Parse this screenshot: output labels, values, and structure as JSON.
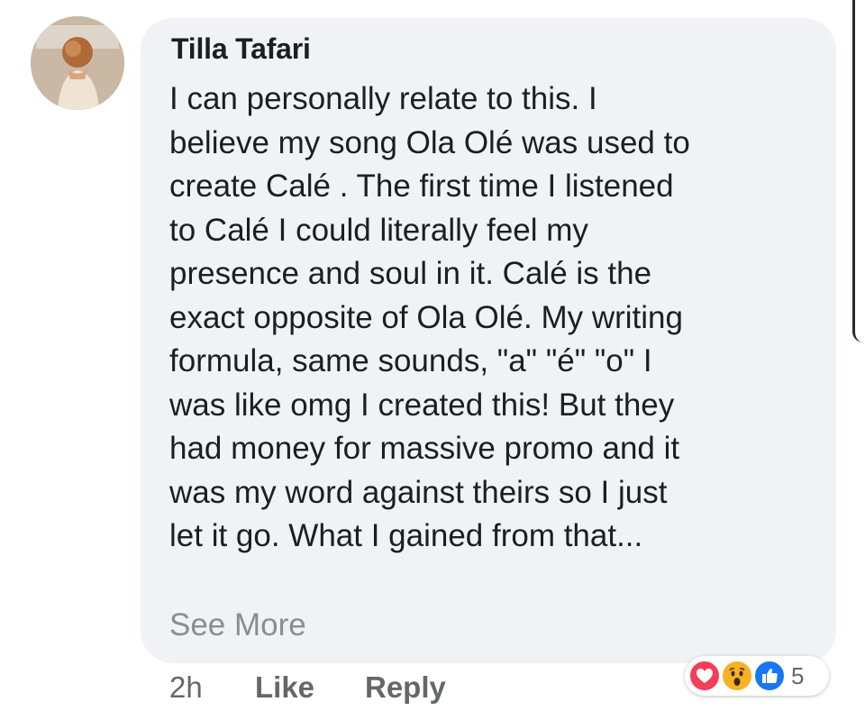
{
  "comment": {
    "author": "Tilla Tafari",
    "text_lines": [
      "I can personally relate to this. I",
      "believe my song Ola Olé was used to",
      "create Calé . The first time I listened",
      "to Calé I could literally feel my",
      "presence and soul in it. Calé is the",
      "exact opposite of Ola Olé. My writing",
      "formula, same sounds, \"a\" \"é\" \"o\" I",
      "was like omg I created this! But they",
      "had money for massive promo and it",
      "was my word against theirs so I just",
      "let it go. What I gained from that..."
    ],
    "see_more_label": "See More"
  },
  "actions": {
    "time": "2h",
    "like_label": "Like",
    "reply_label": "Reply"
  },
  "reactions": {
    "icons": [
      "love-icon",
      "wow-icon",
      "like-icon"
    ],
    "count": "5",
    "colors": {
      "love": "#f33e58",
      "wow": "#f7b125",
      "like": "#1877f2"
    }
  },
  "colors": {
    "bubble_bg": "#f0f2f5",
    "text": "#1c1e21",
    "secondary_text": "#65676b",
    "see_more": "#8a8d91"
  }
}
